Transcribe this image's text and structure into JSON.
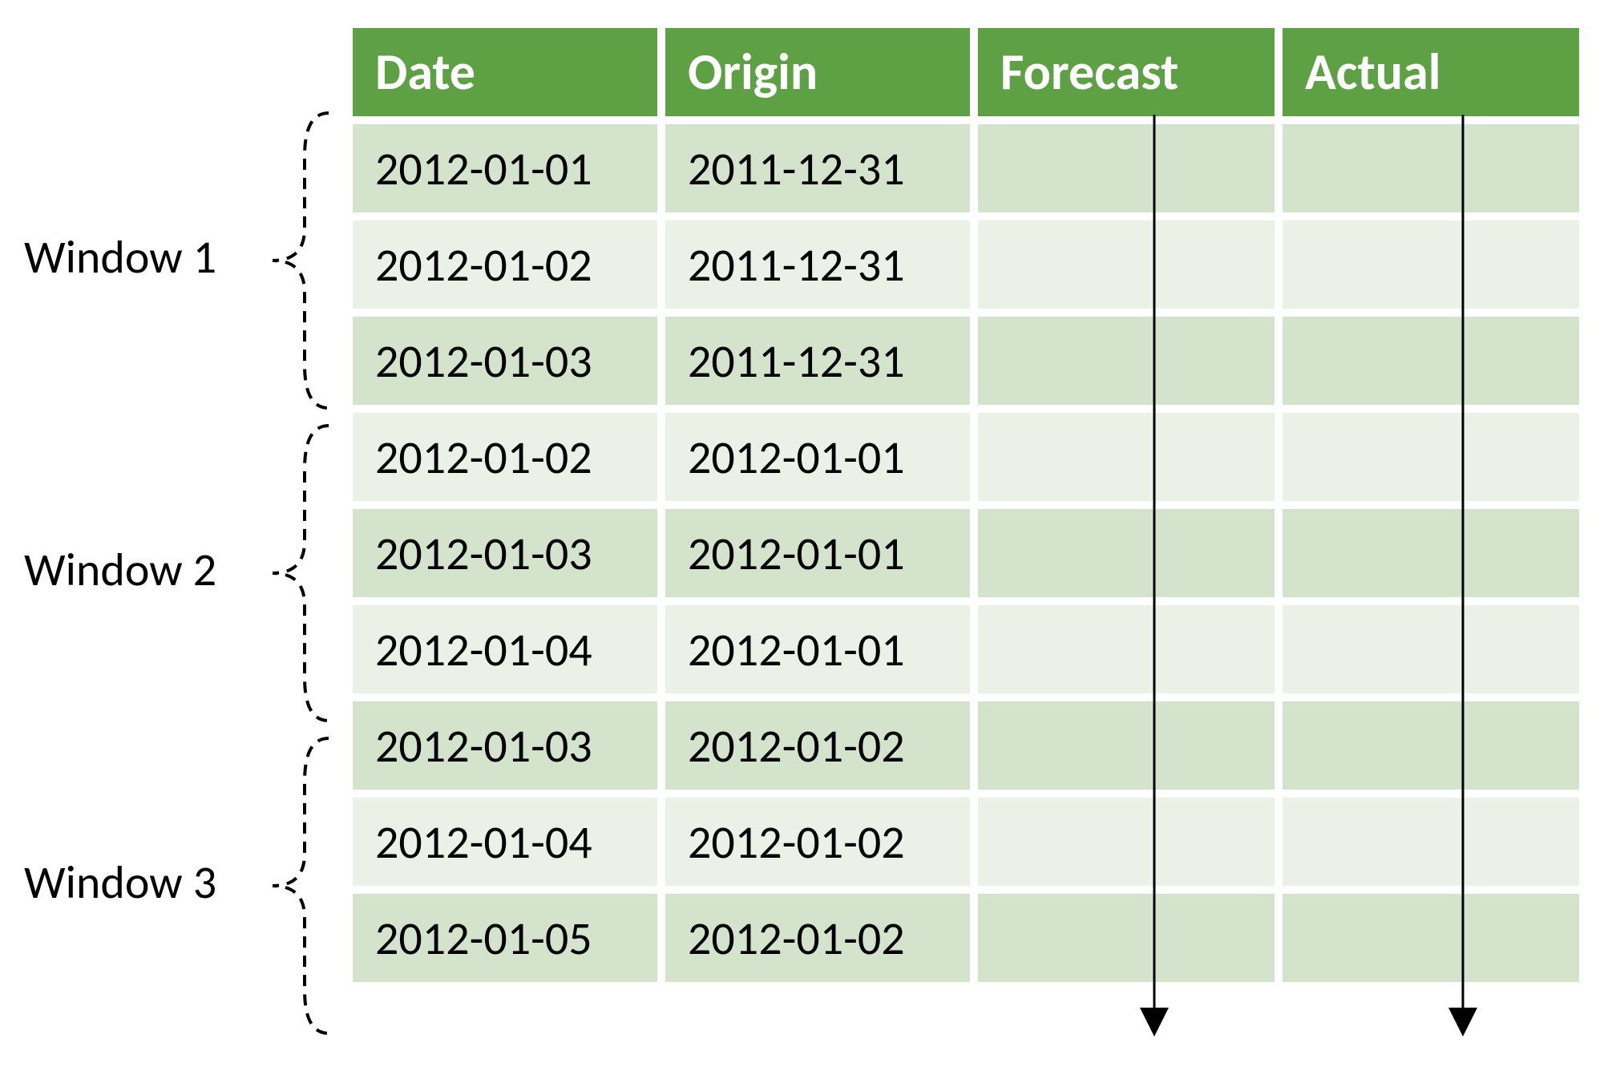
{
  "headers": {
    "date": "Date",
    "origin": "Origin",
    "forecast": "Forecast",
    "actual": "Actual"
  },
  "windows": [
    {
      "label": "Window 1"
    },
    {
      "label": "Window 2"
    },
    {
      "label": "Window 3"
    }
  ],
  "rows": [
    {
      "date": "2012-01-01",
      "origin": "2011-12-31",
      "forecast": "",
      "actual": ""
    },
    {
      "date": "2012-01-02",
      "origin": "2011-12-31",
      "forecast": "",
      "actual": ""
    },
    {
      "date": "2012-01-03",
      "origin": "2011-12-31",
      "forecast": "",
      "actual": ""
    },
    {
      "date": "2012-01-02",
      "origin": "2012-01-01",
      "forecast": "",
      "actual": ""
    },
    {
      "date": "2012-01-03",
      "origin": "2012-01-01",
      "forecast": "",
      "actual": ""
    },
    {
      "date": "2012-01-04",
      "origin": "2012-01-01",
      "forecast": "",
      "actual": ""
    },
    {
      "date": "2012-01-03",
      "origin": "2012-01-02",
      "forecast": "",
      "actual": ""
    },
    {
      "date": "2012-01-04",
      "origin": "2012-01-02",
      "forecast": "",
      "actual": ""
    },
    {
      "date": "2012-01-05",
      "origin": "2012-01-02",
      "forecast": "",
      "actual": ""
    }
  ],
  "chart_data": {
    "type": "table",
    "title": "",
    "columns": [
      "Date",
      "Origin",
      "Forecast",
      "Actual"
    ],
    "groups": [
      {
        "name": "Window 1",
        "rows": [
          [
            "2012-01-01",
            "2011-12-31",
            null,
            null
          ],
          [
            "2012-01-02",
            "2011-12-31",
            null,
            null
          ],
          [
            "2012-01-03",
            "2011-12-31",
            null,
            null
          ]
        ]
      },
      {
        "name": "Window 2",
        "rows": [
          [
            "2012-01-02",
            "2012-01-01",
            null,
            null
          ],
          [
            "2012-01-03",
            "2012-01-01",
            null,
            null
          ],
          [
            "2012-01-04",
            "2012-01-01",
            null,
            null
          ]
        ]
      },
      {
        "name": "Window 3",
        "rows": [
          [
            "2012-01-03",
            "2012-01-02",
            null,
            null
          ],
          [
            "2012-01-04",
            "2012-01-02",
            null,
            null
          ],
          [
            "2012-01-05",
            "2012-01-02",
            null,
            null
          ]
        ]
      }
    ]
  }
}
